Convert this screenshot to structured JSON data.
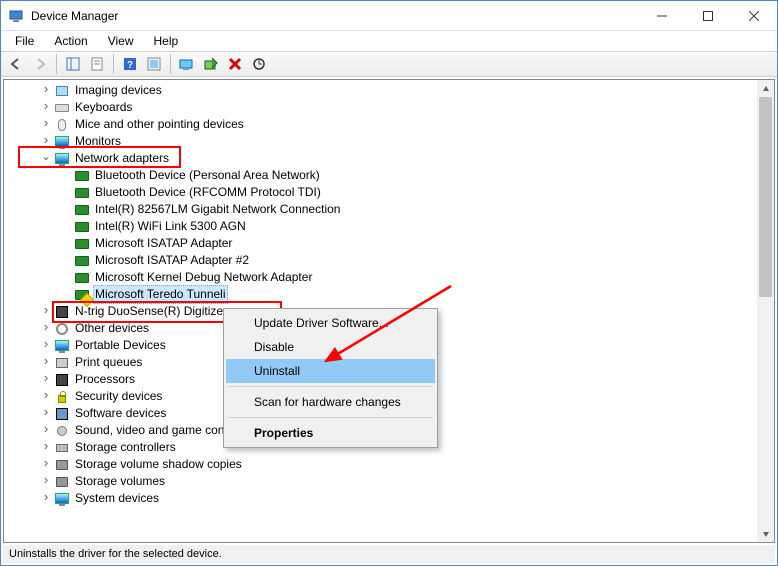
{
  "title": "Device Manager",
  "menu": {
    "file": "File",
    "action": "Action",
    "view": "View",
    "help": "Help"
  },
  "tree": {
    "r0": {
      "label": "Imaging devices"
    },
    "r1": {
      "label": "Keyboards"
    },
    "r2": {
      "label": "Mice and other pointing devices"
    },
    "r3": {
      "label": "Monitors"
    },
    "r4": {
      "label": "Network adapters"
    },
    "r4a": {
      "label": "Bluetooth Device (Personal Area Network)"
    },
    "r4b": {
      "label": "Bluetooth Device (RFCOMM Protocol TDI)"
    },
    "r4c": {
      "label": "Intel(R) 82567LM Gigabit Network Connection"
    },
    "r4d": {
      "label": "Intel(R) WiFi Link 5300 AGN"
    },
    "r4e": {
      "label": "Microsoft ISATAP Adapter"
    },
    "r4f": {
      "label": "Microsoft ISATAP Adapter #2"
    },
    "r4g": {
      "label": "Microsoft Kernel Debug Network Adapter"
    },
    "r4h": {
      "label": "Microsoft Teredo Tunneli"
    },
    "r5": {
      "label": "N-trig DuoSense(R) Digitizer"
    },
    "r6": {
      "label": "Other devices"
    },
    "r7": {
      "label": "Portable Devices"
    },
    "r8": {
      "label": "Print queues"
    },
    "r9": {
      "label": "Processors"
    },
    "r10": {
      "label": "Security devices"
    },
    "r11": {
      "label": "Software devices"
    },
    "r12": {
      "label": "Sound, video and game controllers"
    },
    "r13": {
      "label": "Storage controllers"
    },
    "r14": {
      "label": "Storage volume shadow copies"
    },
    "r15": {
      "label": "Storage volumes"
    },
    "r16": {
      "label": "System devices"
    }
  },
  "ctx": {
    "update": "Update Driver Software...",
    "disable": "Disable",
    "uninstall": "Uninstall",
    "scan": "Scan for hardware changes",
    "properties": "Properties"
  },
  "status": "Uninstalls the driver for the selected device."
}
